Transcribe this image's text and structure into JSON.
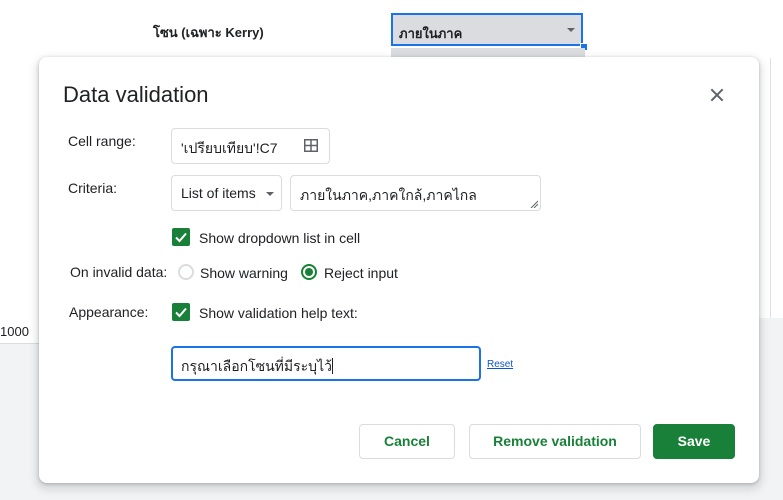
{
  "sheet": {
    "row_label": "โซน (เฉพาะ Kerry)",
    "cell_value": "ภายในภาค",
    "left_number": "1000"
  },
  "dialog": {
    "title": "Data validation",
    "cell_range": {
      "label": "Cell range:",
      "value": "'เปรียบเทียบ'!C7"
    },
    "criteria": {
      "label": "Criteria:",
      "type": "List of items",
      "items": "ภายในภาค,ภาคใกล้,ภาคไกล"
    },
    "show_dropdown": {
      "label": "Show dropdown list in cell",
      "checked": true
    },
    "on_invalid": {
      "label": "On invalid data:",
      "options": [
        "Show warning",
        "Reject input"
      ],
      "selected": "Reject input"
    },
    "appearance": {
      "label": "Appearance:",
      "help_text_label": "Show validation help text:",
      "checked": true,
      "help_text": "กรุณาเลือกโซนที่มีระบุไว้",
      "reset_label": "Reset"
    },
    "buttons": {
      "cancel": "Cancel",
      "remove": "Remove validation",
      "save": "Save"
    }
  },
  "colors": {
    "accent": "#188038",
    "focus": "#1a73e8",
    "link": "#1155cc"
  }
}
